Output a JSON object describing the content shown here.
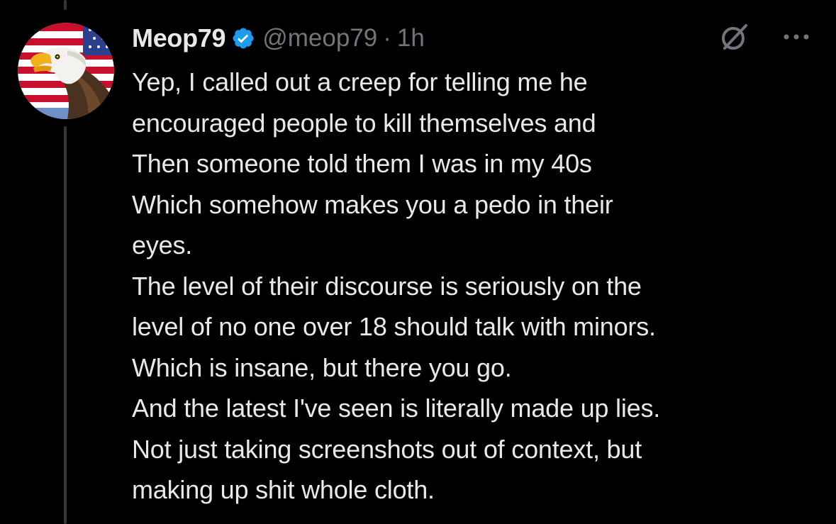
{
  "colors": {
    "background": "#000000",
    "text_primary": "#e7e9ea",
    "text_secondary": "#71767b",
    "verified_blue": "#1d9bf0",
    "thread_line": "#333639"
  },
  "tweet": {
    "author": {
      "display_name": "Meop79",
      "handle": "@meop79",
      "verified": true,
      "avatar_icon": "bald-eagle-american-flag-avatar"
    },
    "separator": "·",
    "time": "1h",
    "icons": {
      "verified": "verified-badge-icon",
      "grok": "grok-icon",
      "more": "more-options-icon"
    },
    "text_lines": [
      "Yep, I called out a creep for telling me he",
      "encouraged people to kill themselves and",
      "Then someone told them I was in my 40s",
      "Which somehow makes you a pedo in their",
      "eyes.",
      "The level of their discourse is seriously on the",
      "level of no one over 18 should talk with minors.",
      "Which is insane, but there you go.",
      "And the latest I've seen is literally made up lies.",
      "Not just taking screenshots out of context, but",
      "making up shit whole cloth."
    ]
  }
}
